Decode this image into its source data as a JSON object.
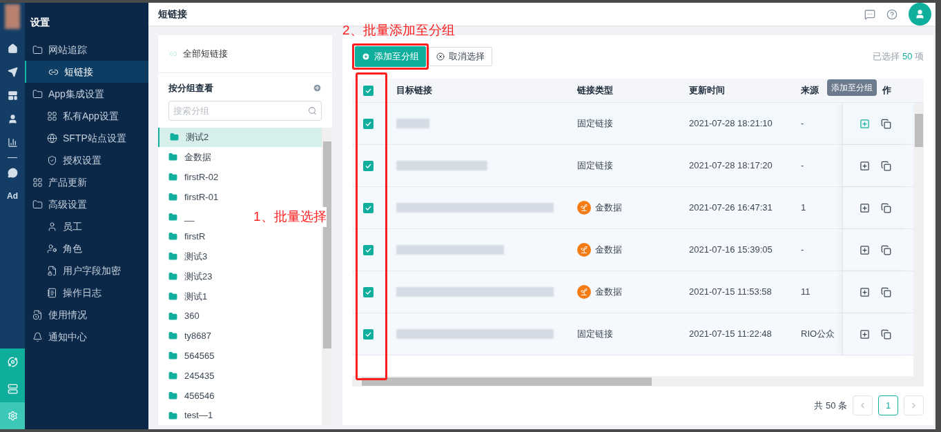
{
  "header": {
    "title": "短链接"
  },
  "nav": {
    "title": "设置",
    "items": [
      {
        "label": "网站追踪",
        "selected": false,
        "children": [
          {
            "label": "短链接",
            "selected": true
          }
        ]
      },
      {
        "label": "App集成设置",
        "selected": false,
        "children": [
          {
            "label": "私有App设置",
            "selected": false
          },
          {
            "label": "SFTP站点设置",
            "selected": false
          },
          {
            "label": "授权设置",
            "selected": false
          }
        ]
      },
      {
        "label": "产品更新",
        "selected": false
      },
      {
        "label": "高级设置",
        "selected": false,
        "children": [
          {
            "label": "员工",
            "selected": false
          },
          {
            "label": "角色",
            "selected": false
          },
          {
            "label": "用户字段加密",
            "selected": false
          },
          {
            "label": "操作日志",
            "selected": false
          }
        ]
      },
      {
        "label": "使用情况",
        "selected": false
      },
      {
        "label": "通知中心",
        "selected": false
      }
    ]
  },
  "rail": {
    "ad_label": "Ad",
    "bottom": [
      {
        "selected": false
      },
      {
        "selected": false
      },
      {
        "selected": true
      }
    ]
  },
  "groups": {
    "all_label": "全部短链接",
    "section_title": "按分组查看",
    "search": {
      "placeholder": "搜索分组"
    },
    "items": [
      {
        "label": "测试2",
        "selected": true
      },
      {
        "label": "金数据",
        "selected": false
      },
      {
        "label": "firstR-02",
        "selected": false
      },
      {
        "label": "firstR-01",
        "selected": false
      },
      {
        "label": "__",
        "selected": false
      },
      {
        "label": "firstR",
        "selected": false
      },
      {
        "label": "测试3",
        "selected": false
      },
      {
        "label": "测试23",
        "selected": false
      },
      {
        "label": "测试1",
        "selected": false
      },
      {
        "label": "360",
        "selected": false
      },
      {
        "label": "ty8687",
        "selected": false
      },
      {
        "label": "564565",
        "selected": false
      },
      {
        "label": "245435",
        "selected": false
      },
      {
        "label": "456546",
        "selected": false
      },
      {
        "label": "test—1",
        "selected": false
      }
    ]
  },
  "toolbar": {
    "add_button": "添加至分组",
    "cancel_button": "取消选择",
    "selection": {
      "prefix": "已选择",
      "count": "50",
      "suffix": "项"
    }
  },
  "table": {
    "all_checked": true,
    "columns": [
      "目标链接",
      "链接类型",
      "更新时间",
      "来源",
      "作"
    ],
    "tooltip": "添加至分组",
    "rows": [
      {
        "checked": true,
        "type": {
          "kind": "fixed",
          "label": "固定链接"
        },
        "updated": "2021-07-28 18:21:10",
        "source": "-",
        "hovered": true
      },
      {
        "checked": true,
        "type": {
          "kind": "fixed",
          "label": "固定链接"
        },
        "updated": "2021-07-28 18:17:20",
        "source": "-",
        "hovered": false
      },
      {
        "checked": true,
        "type": {
          "kind": "group",
          "label": "金数据"
        },
        "updated": "2021-07-26 16:47:31",
        "source": "1",
        "hovered": false
      },
      {
        "checked": true,
        "type": {
          "kind": "group",
          "label": "金数据"
        },
        "updated": "2021-07-16 15:39:05",
        "source": "-",
        "hovered": false
      },
      {
        "checked": true,
        "type": {
          "kind": "group",
          "label": "金数据"
        },
        "updated": "2021-07-15 11:53:58",
        "source": "11",
        "hovered": false
      },
      {
        "checked": true,
        "type": {
          "kind": "fixed",
          "label": "固定链接"
        },
        "updated": "2021-07-15 11:22:48",
        "source": "RIO公众",
        "hovered": false
      }
    ]
  },
  "pagination": {
    "total": "共 50 条",
    "pages": [
      {
        "label": "1",
        "selected": true
      }
    ]
  },
  "annotations": [
    {
      "text": "1、批量选择"
    },
    {
      "text": "2、批量添加至分组"
    }
  ]
}
